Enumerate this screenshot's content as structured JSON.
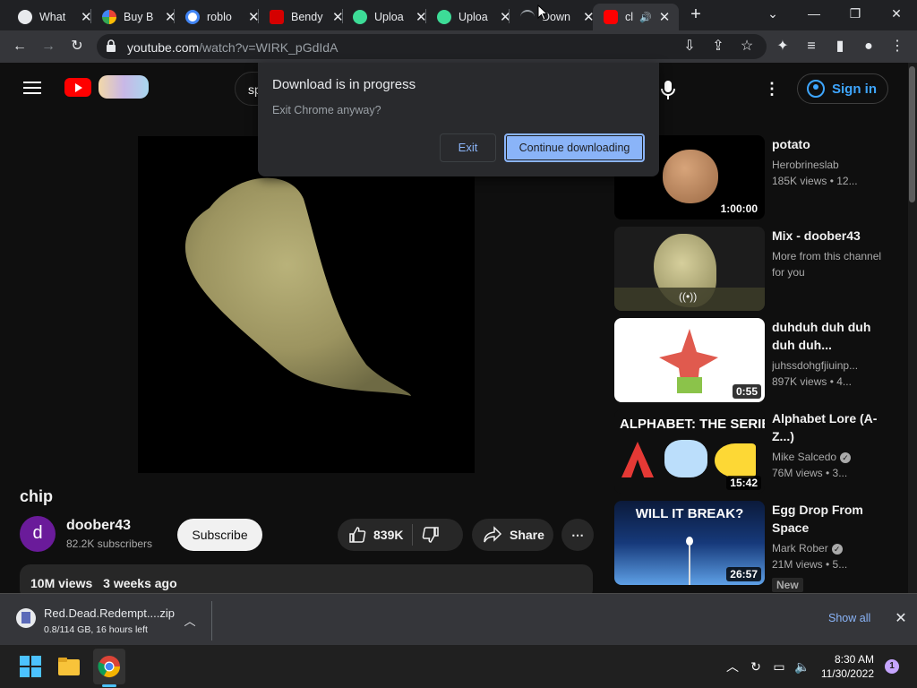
{
  "browser": {
    "tabs": [
      {
        "title": "What",
        "icon": "github-icon",
        "color": "#e8eaed"
      },
      {
        "title": "Buy B",
        "icon": "store-icon",
        "color": "#f4b400"
      },
      {
        "title": "roblo",
        "icon": "google-icon",
        "color": "#4285f4"
      },
      {
        "title": "Bendy",
        "icon": "bendy-icon",
        "color": "#ff3b30"
      },
      {
        "title": "Uploa",
        "icon": "cloud-icon",
        "color": "#34a853"
      },
      {
        "title": "Uploa",
        "icon": "cloud-icon",
        "color": "#34a853"
      },
      {
        "title": "Down",
        "icon": "loading-icon",
        "color": "#9aa0a6"
      },
      {
        "title": "cl",
        "icon": "youtube-icon",
        "color": "#ff0000"
      }
    ],
    "url_host": "youtube.com",
    "url_path": "/watch?v=WIRK_pGdIdA"
  },
  "youtube": {
    "search_prefix": "sp",
    "sign_in": "Sign in",
    "video": {
      "title": "chip",
      "channel": "doober43",
      "avatar_letter": "d",
      "subscribers": "82.2K subscribers",
      "subscribe": "Subscribe",
      "likes": "839K",
      "share": "Share",
      "views": "10M views",
      "age": "3 weeks ago"
    },
    "recommendations": [
      {
        "title": "potato",
        "channel": "Herobrineslab",
        "meta": "185K views  •  12...",
        "duration": "1:00:00",
        "verified": false
      },
      {
        "title": "Mix - doober43",
        "channel": "More from this channel for you",
        "meta": "",
        "duration": "",
        "verified": false
      },
      {
        "title": "duhduh duh duh duh duh...",
        "channel": "juhssdohgfjiuinp...",
        "meta": "897K views  •  4...",
        "duration": "0:55",
        "verified": false
      },
      {
        "title": "Alphabet Lore (A-Z...)",
        "channel": "Mike Salcedo",
        "meta": "76M views  •  3...",
        "duration": "15:42",
        "verified": true
      },
      {
        "title": "Egg Drop From Space",
        "channel": "Mark Rober",
        "meta": "21M views  •  5...",
        "duration": "26:57",
        "verified": true,
        "badge": "New"
      }
    ],
    "thumb_texts": {
      "alphabet": "ALPHABET: THE SERIES",
      "egg": "WILL IT BREAK?"
    }
  },
  "dialog": {
    "title": "Download is in progress",
    "body": "Exit Chrome anyway?",
    "exit": "Exit",
    "continue": "Continue downloading"
  },
  "downloads": {
    "file": "Red.Dead.Redempt....zip",
    "status": "0.8/114 GB, 16 hours left",
    "show_all": "Show all"
  },
  "taskbar": {
    "time": "8:30 AM",
    "date": "11/30/2022",
    "notifications": "1"
  }
}
